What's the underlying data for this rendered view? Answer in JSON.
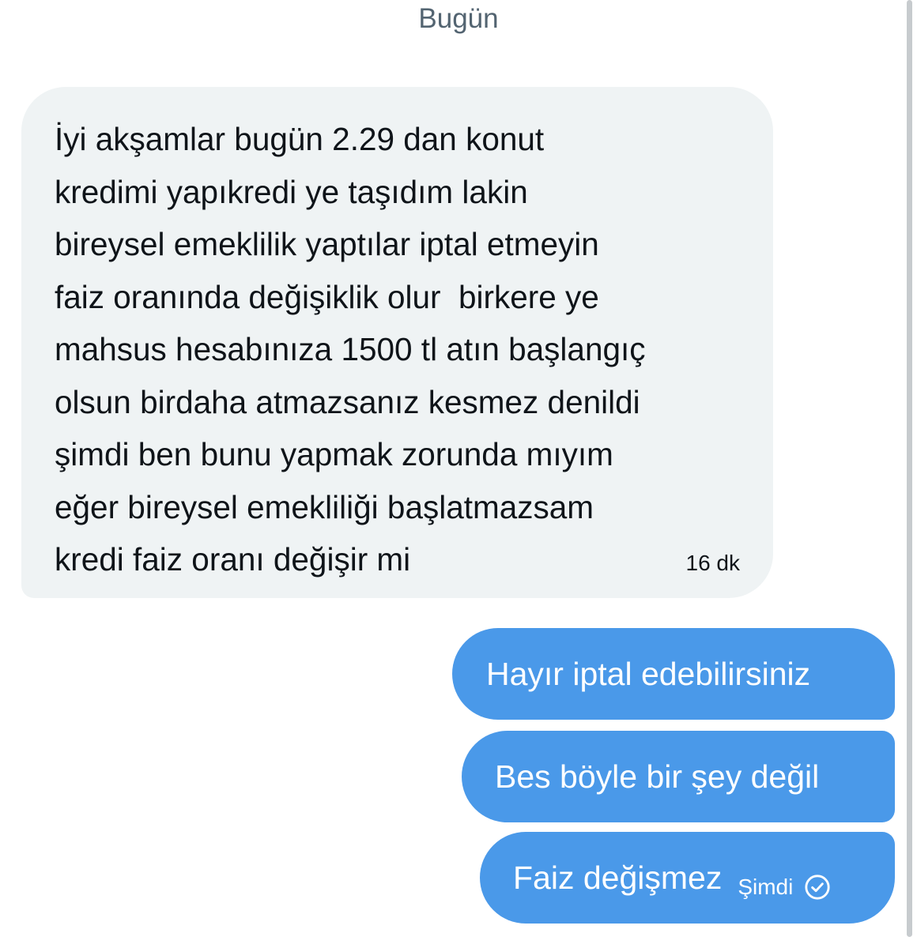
{
  "date_separator": "Bugün",
  "incoming_message": {
    "text": "İyi akşamlar bugün 2.29 dan konut\nkredimi yapıkredi ye taşıdım lakin\nbireysel emeklilik yaptılar iptal etmeyin\nfaiz oranında değişiklik olur  birkere ye\nmahsus hesabınıza 1500 tl atın başlangıç\nolsun birdaha atmazsanız kesmez denildi\nşimdi ben bunu yapmak zorunda mıyım\neğer bireysel emekliliği başlatmazsam\nkredi faiz oranı değişir mi",
    "time": "16 dk",
    "bubble_color": "#eff3f4"
  },
  "outgoing_messages": [
    {
      "text": "Hayır iptal edebilirsiniz"
    },
    {
      "text": "Bes böyle bir şey değil"
    },
    {
      "text": "Faiz değişmez",
      "time": "Şimdi",
      "status_icon": "check-circle-icon"
    }
  ],
  "colors": {
    "outgoing_bubble": "#4a99e9",
    "secondary_text": "#536471"
  }
}
